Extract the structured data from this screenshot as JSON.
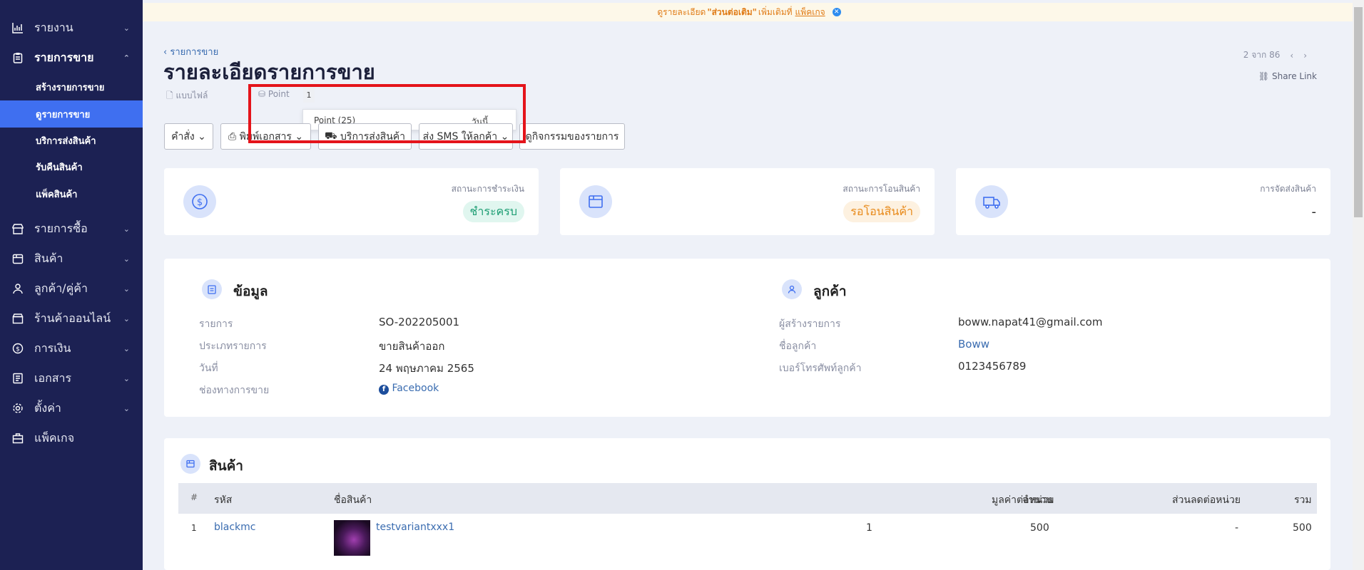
{
  "sidebar": {
    "items": [
      {
        "label": "รายงาน",
        "icon": "chart-icon"
      },
      {
        "label": "รายการขาย",
        "icon": "clipboard-icon"
      },
      {
        "label": "รายการซื้อ",
        "icon": "store-icon"
      },
      {
        "label": "สินค้า",
        "icon": "box-icon"
      },
      {
        "label": "ลูกค้า/คู่ค้า",
        "icon": "users-icon"
      },
      {
        "label": "ร้านค้าออนไลน์",
        "icon": "shop-icon"
      },
      {
        "label": "การเงิน",
        "icon": "dollar-icon"
      },
      {
        "label": "เอกสาร",
        "icon": "document-icon"
      },
      {
        "label": "ตั้งค่า",
        "icon": "gear-icon"
      },
      {
        "label": "แพ็คเกจ",
        "icon": "package-icon"
      }
    ],
    "sales_sub": [
      "สร้างรายการขาย",
      "ดูรายการขาย",
      "บริการส่งสินค้า",
      "รับคืนสินค้า",
      "แพ็คสินค้า"
    ]
  },
  "banner": {
    "prefix": "ดูรายละเอียด",
    "highlight": "\"ส่วนต่อเติม\"",
    "middle": "เพิ่มเติมที่",
    "link": "แพ็คเกจ"
  },
  "header": {
    "breadcrumb": "รายการขาย",
    "title": "รายละเอียดรายการขาย",
    "template": "แบบไฟล์",
    "point_label": "Point",
    "point_count": "1",
    "popup_point": "Point (25)",
    "popup_date": "วันนี้",
    "pager": "2 จาก 86",
    "share": "Share Link"
  },
  "toolbar": {
    "commands": "คำสั่ง",
    "print": "พิมพ์เอกสาร",
    "shipping": "บริการส่งสินค้า",
    "sms": "ส่ง SMS ให้ลูกค้า",
    "activity": "ดูกิจกรรมของรายการ"
  },
  "status": [
    {
      "label": "สถานะการชำระเงิน",
      "value": "ชำระครบ",
      "color": "#e0f6ef",
      "text_color": "#1e9e74",
      "icon": "dollar-icon"
    },
    {
      "label": "สถานะการโอนสินค้า",
      "value": "รอโอนสินค้า",
      "color": "#fdf1e0",
      "text_color": "#e88a1a",
      "icon": "box-icon"
    },
    {
      "label": "การจัดส่งสินค้า",
      "value": "-",
      "icon": "truck-icon"
    }
  ],
  "info": {
    "title": "ข้อมูล",
    "rows": [
      {
        "label": "รายการ",
        "value": "SO-202205001"
      },
      {
        "label": "ประเภทรายการ",
        "value": "ขายสินค้าออก"
      },
      {
        "label": "วันที่",
        "value": "24 พฤษภาคม 2565"
      },
      {
        "label": "ช่องทางการขาย",
        "value": "Facebook"
      }
    ]
  },
  "customer": {
    "title": "ลูกค้า",
    "rows": [
      {
        "label": "ผู้สร้างรายการ",
        "value": "boww.napat41@gmail.com"
      },
      {
        "label": "ชื่อลูกค้า",
        "value": "Boww"
      },
      {
        "label": "เบอร์โทรศัพท์ลูกค้า",
        "value": "0123456789"
      }
    ]
  },
  "products": {
    "title": "สินค้า",
    "columns": [
      "#",
      "รหัส",
      "ชื่อสินค้า",
      "จำนวน",
      "มูลค่าต่อหน่วย",
      "ส่วนลดต่อหน่วย",
      "รวม"
    ],
    "rows": [
      {
        "no": "1",
        "code": "blackmc",
        "name": "testvariantxxx1",
        "qty": "1",
        "price": "500",
        "discount": "-",
        "total": "500"
      }
    ]
  }
}
